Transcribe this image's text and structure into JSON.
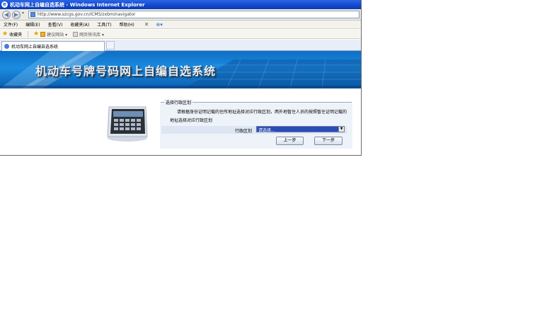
{
  "window": {
    "title": "机动车网上自编自选系统 - Windows Internet Explorer"
  },
  "address_bar": {
    "url": "http://www.szcgs.gov.cn/ICMS/zxbm/navigator"
  },
  "menu": {
    "items": [
      "文件(F)",
      "编辑(E)",
      "查看(V)",
      "收藏夹(A)",
      "工具(T)",
      "帮助(H)"
    ]
  },
  "favorites_bar": {
    "favorites_label": "收藏夹",
    "links": [
      "建议网站 ▾",
      "网页快讯库 ▾"
    ]
  },
  "tab": {
    "label": "机动车网上自编自选系统"
  },
  "banner": {
    "title": "机动车号牌号码网上自编自选系统"
  },
  "form": {
    "legend": "选择行政区划",
    "notice": "请根据身份证明记载的住所地址选择对应行政区划，两外地暂住人员的按照暂住证明记载的地址选择对应行政区划",
    "district_label": "行政区划",
    "district_selected": "请选择...",
    "prev_button": "上一步",
    "next_button": "下一步"
  },
  "colors": {
    "titlebar": "#1248cc",
    "banner": "#1a8be0",
    "panel": "#eef3f9",
    "select_highlight": "#2a4bbb"
  }
}
